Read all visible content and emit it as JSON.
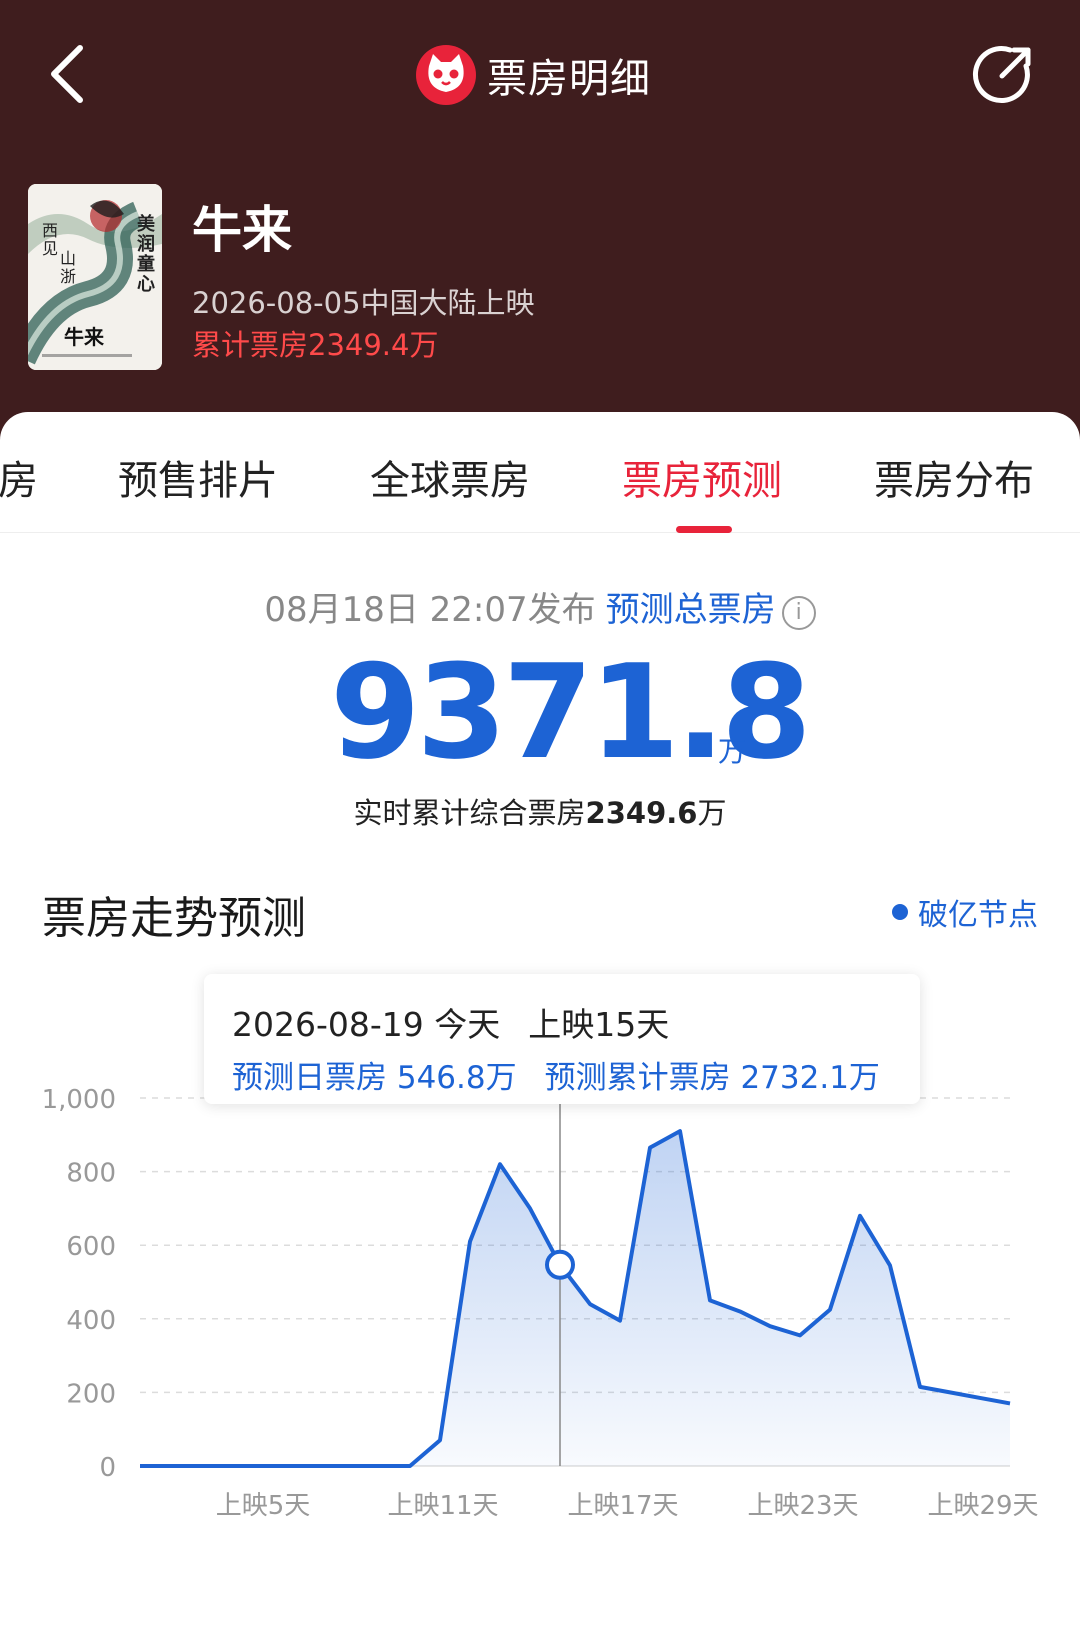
{
  "nav": {
    "title": "票房明细",
    "back_icon": "chevron-left-icon",
    "share_icon": "share-icon"
  },
  "movie": {
    "title": "牛来",
    "release": "2026-08-05中国大陆上映",
    "cumulative": "累计票房2349.4万",
    "poster_text": {
      "vertical_right": "美润童心",
      "vertical_left": "西见山浙",
      "bottom": "牛来"
    }
  },
  "tabs": [
    {
      "label": "房",
      "active": false
    },
    {
      "label": "预售排片",
      "active": false
    },
    {
      "label": "全球票房",
      "active": false
    },
    {
      "label": "票房预测",
      "active": true
    },
    {
      "label": "票房分布",
      "active": false
    }
  ],
  "forecast": {
    "published": "08月18日 22:07发布",
    "label": "预测总票房",
    "value": "9371.8",
    "unit": "万",
    "realtime_prefix": "实时累计综合票房",
    "realtime_value": "2349.6",
    "realtime_unit": "万"
  },
  "trend": {
    "title": "票房走势预测",
    "legend": "破亿节点",
    "tooltip": {
      "date": "2026-08-19",
      "today": "今天",
      "day": "上映15天",
      "daily": "预测日票房 546.8万",
      "cumulative": "预测累计票房 2732.1万"
    }
  },
  "colors": {
    "accent_red": "#e8233a",
    "brand_blue": "#1d63d4",
    "header_bg": "#3f1d1e"
  },
  "chart_data": {
    "type": "area",
    "x_label_prefix": "上映",
    "x_label_suffix": "天",
    "xticks": [
      5,
      11,
      17,
      23,
      29
    ],
    "xtick_labels": [
      "上映5天",
      "上映11天",
      "上映17天",
      "上映23天",
      "上映29天"
    ],
    "yticks": [
      0,
      200,
      400,
      600,
      800,
      1000
    ],
    "ytick_labels": [
      "0",
      "200",
      "400",
      "600",
      "800",
      "1,000"
    ],
    "ylim": [
      0,
      1000
    ],
    "xlim": [
      1,
      30
    ],
    "grid": true,
    "x": [
      1,
      2,
      3,
      4,
      5,
      6,
      7,
      8,
      9,
      10,
      11,
      12,
      13,
      14,
      15,
      16,
      17,
      18,
      19,
      20,
      21,
      22,
      23,
      24,
      25,
      26,
      27,
      28,
      29,
      30
    ],
    "values": [
      0,
      0,
      0,
      0,
      0,
      0,
      0,
      0,
      0,
      0,
      70,
      610,
      820,
      700,
      546.8,
      440,
      395,
      865,
      910,
      450,
      420,
      380,
      355,
      425,
      680,
      545,
      215,
      200,
      185,
      170
    ],
    "highlight_x": 15
  }
}
